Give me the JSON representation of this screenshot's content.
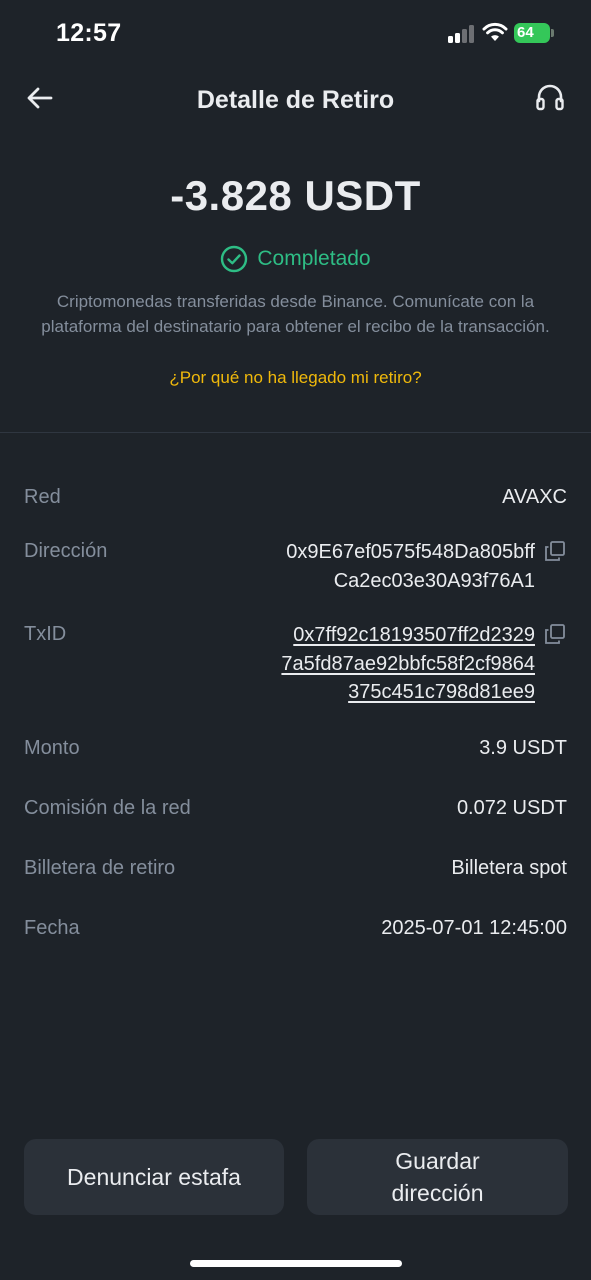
{
  "status_bar": {
    "time": "12:57",
    "battery_level": "64"
  },
  "header": {
    "title": "Detalle de Retiro",
    "back_icon": "arrow-left-icon",
    "support_icon": "headset-icon"
  },
  "summary": {
    "amount": "-3.828 USDT",
    "status": "Completado",
    "status_color": "#2ebd85",
    "description": "Criptomonedas transferidas desde Binance. Comunícate con la plataforma del destinatario para obtener el recibo de la transacción.",
    "help_link": "¿Por qué no ha llegado mi retiro?",
    "link_color": "#f0b90b"
  },
  "details": {
    "red": {
      "label": "Red",
      "value": "AVAXC"
    },
    "direccion": {
      "label": "Dirección",
      "lines": [
        "0x9E67ef0575f548Da805bff",
        "Ca2ec03e30A93f76A1"
      ]
    },
    "txid": {
      "label": "TxID",
      "lines": [
        "0x7ff92c18193507ff2d2329",
        "7a5fd87ae92bbfc58f2cf9864",
        "375c451c798d81ee9"
      ]
    },
    "monto": {
      "label": "Monto",
      "value": "3.9 USDT"
    },
    "comision": {
      "label": "Comisión de la red",
      "value": "0.072 USDT"
    },
    "billetera": {
      "label": "Billetera de retiro",
      "value": "Billetera spot"
    },
    "fecha": {
      "label": "Fecha",
      "value": "2025-07-01 12:45:00"
    }
  },
  "buttons": {
    "report": "Denunciar estafa",
    "save_line1": "Guardar",
    "save_line2": "dirección"
  },
  "colors": {
    "background": "#1e2329",
    "text_primary": "#eaecef",
    "text_secondary": "#848e9c",
    "button_bg": "#2b3139"
  }
}
